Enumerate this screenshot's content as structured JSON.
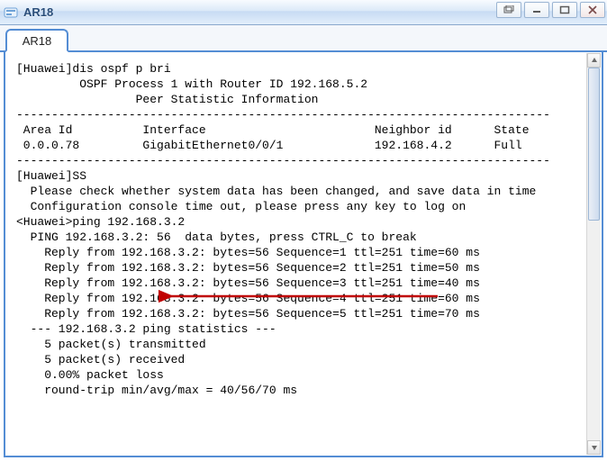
{
  "window": {
    "title": "AR18"
  },
  "tabs": [
    {
      "label": "AR18"
    }
  ],
  "terminal": {
    "lines": [
      "[Huawei]dis ospf p bri",
      "",
      "\t OSPF Process 1 with Router ID 192.168.5.2",
      "\t\t Peer Statistic Information",
      "----------------------------------------------------------------------------",
      " Area Id          Interface                        Neighbor id      State",
      " 0.0.0.78         GigabitEthernet0/0/1             192.168.4.2      Full",
      "----------------------------------------------------------------------------",
      "[Huawei]SS",
      "",
      "  Please check whether system data has been changed, and save data in time",
      "",
      "  Configuration console time out, please press any key to log on",
      "",
      "<Huawei>ping 192.168.3.2",
      "  PING 192.168.3.2: 56  data bytes, press CTRL_C to break",
      "    Reply from 192.168.3.2: bytes=56 Sequence=1 ttl=251 time=60 ms",
      "    Reply from 192.168.3.2: bytes=56 Sequence=2 ttl=251 time=50 ms",
      "    Reply from 192.168.3.2: bytes=56 Sequence=3 ttl=251 time=40 ms",
      "    Reply from 192.168.3.2: bytes=56 Sequence=4 ttl=251 time=60 ms",
      "    Reply from 192.168.3.2: bytes=56 Sequence=5 ttl=251 time=70 ms",
      "",
      "  --- 192.168.3.2 ping statistics ---",
      "    5 packet(s) transmitted",
      "    5 packet(s) received",
      "    0.00% packet loss",
      "    round-trip min/avg/max = 40/56/70 ms"
    ]
  },
  "chart_data": {
    "type": "table",
    "title": "OSPF Peer Statistic Information",
    "process": 1,
    "router_id": "192.168.5.2",
    "columns": [
      "Area Id",
      "Interface",
      "Neighbor id",
      "State"
    ],
    "rows": [
      [
        "0.0.0.78",
        "GigabitEthernet0/0/1",
        "192.168.4.2",
        "Full"
      ]
    ],
    "ping": {
      "target": "192.168.3.2",
      "bytes": 56,
      "replies": [
        {
          "seq": 1,
          "ttl": 251,
          "time_ms": 60
        },
        {
          "seq": 2,
          "ttl": 251,
          "time_ms": 50
        },
        {
          "seq": 3,
          "ttl": 251,
          "time_ms": 40
        },
        {
          "seq": 4,
          "ttl": 251,
          "time_ms": 60
        },
        {
          "seq": 5,
          "ttl": 251,
          "time_ms": 70
        }
      ],
      "transmitted": 5,
      "received": 5,
      "loss_pct": 0.0,
      "rtt_min_ms": 40,
      "rtt_avg_ms": 56,
      "rtt_max_ms": 70
    }
  }
}
